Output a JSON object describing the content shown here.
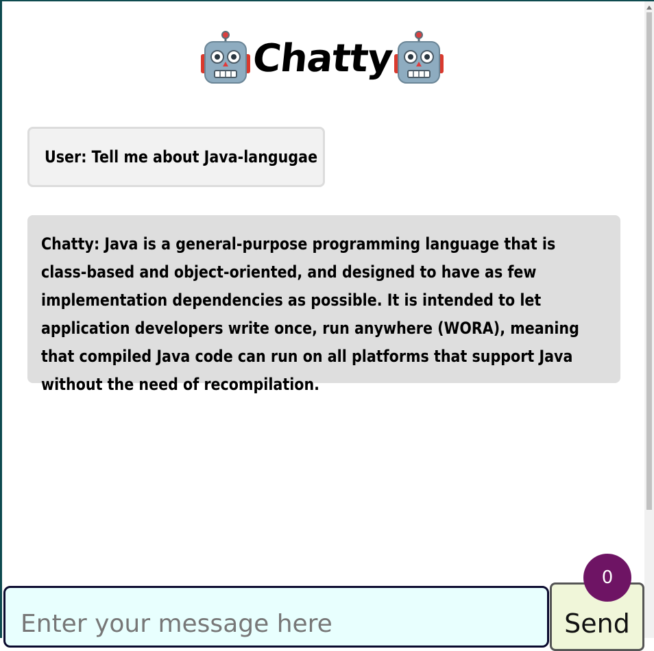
{
  "header": {
    "title": "Chatty",
    "left_icon": "robot-icon",
    "right_icon": "robot-icon"
  },
  "messages": [
    {
      "speaker": "User",
      "text": "User: Tell me about Java-langugae"
    },
    {
      "speaker": "Chatty",
      "text": "Chatty: Java is a general-purpose programming language that is class-based and object-oriented, and designed to have as few implementation dependencies as possible. It is intended to let application developers write once, run anywhere (WORA), meaning that compiled Java code can run on all platforms that support Java without the need of recompilation."
    }
  ],
  "composer": {
    "placeholder": "Enter your message here",
    "value": "",
    "send_label": "Send"
  },
  "badge": {
    "count": "0",
    "color": "#6e1464"
  },
  "colors": {
    "user_bubble": "#f2f2f2",
    "bot_bubble": "#dedede",
    "input_bg": "#e8fffe",
    "send_bg": "#f0f6d9"
  }
}
